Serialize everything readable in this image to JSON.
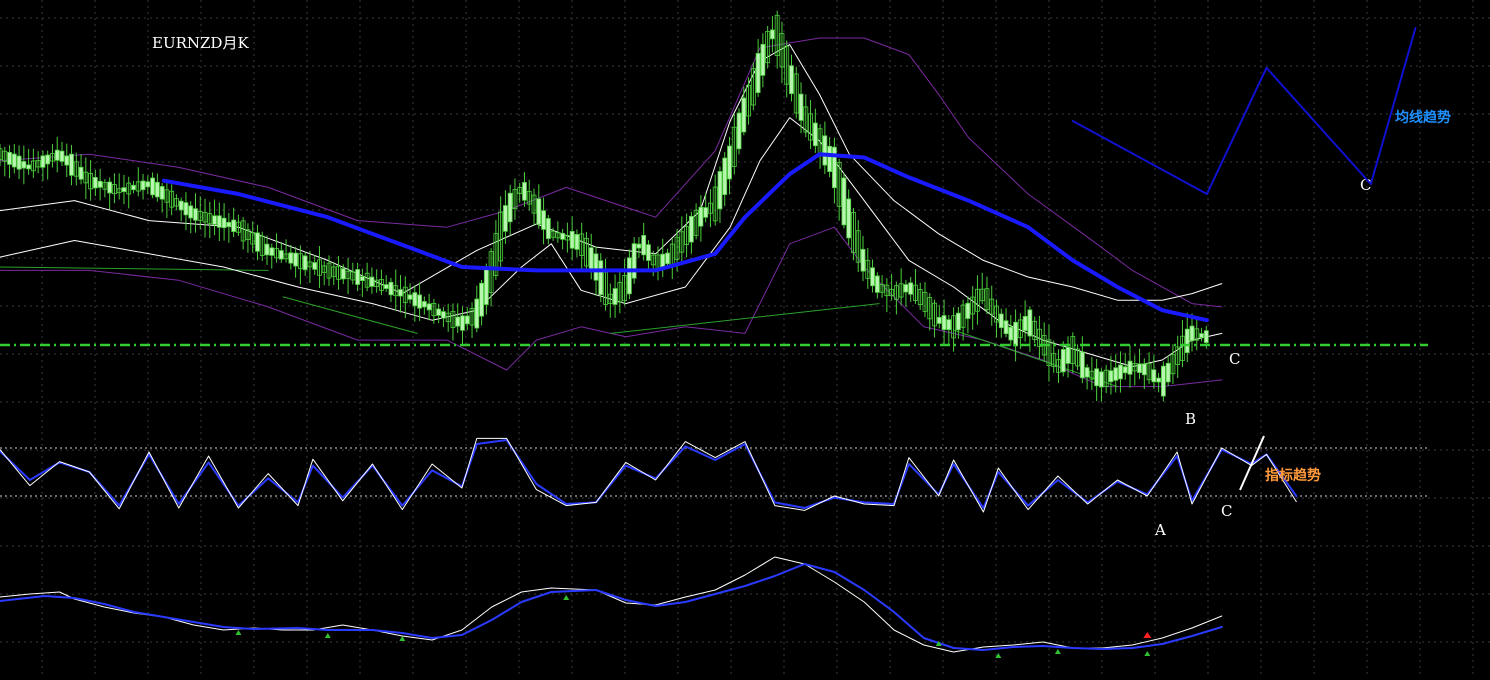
{
  "chart_data": {
    "type": "line",
    "title": "EURNZD月K",
    "grid": true,
    "colors": {
      "background": "#000000",
      "grid": "#3a3a3a",
      "candle": "#b8f5b0",
      "candle_edge": "#4ccf3c",
      "ma": "#1a1aff",
      "band_inner": "#ffffff",
      "band_outer": "#7a2aa0",
      "support": "#33cc33",
      "trendline": "#2aa02a",
      "osc_fast": "#ffffff",
      "osc_slow": "#2a3aff",
      "annot_blue": "#1e90ff",
      "annot_orange": "#ff9a3c",
      "arrow_red": "#ff2020"
    },
    "x_range": [
      0,
      100
    ],
    "price_panel": {
      "y_range": [
        0,
        100
      ],
      "ma_line": [
        [
          11,
          54
        ],
        [
          16,
          50
        ],
        [
          22,
          43
        ],
        [
          28,
          33
        ],
        [
          31,
          28
        ],
        [
          36,
          27
        ],
        [
          40,
          27
        ],
        [
          44,
          27
        ],
        [
          48,
          32
        ],
        [
          50,
          43
        ],
        [
          53,
          56
        ],
        [
          55,
          62
        ],
        [
          58,
          61
        ],
        [
          61,
          55
        ],
        [
          65,
          48
        ],
        [
          69,
          40
        ],
        [
          72,
          30
        ],
        [
          75,
          22
        ],
        [
          78,
          15
        ],
        [
          81,
          12
        ]
      ],
      "upper_inner": [
        [
          0,
          45
        ],
        [
          5,
          48
        ],
        [
          10,
          42
        ],
        [
          16,
          40
        ],
        [
          22,
          30
        ],
        [
          27,
          20
        ],
        [
          32,
          33
        ],
        [
          36,
          41
        ],
        [
          40,
          34
        ],
        [
          44,
          32
        ],
        [
          47,
          45
        ],
        [
          49,
          72
        ],
        [
          51,
          90
        ],
        [
          53,
          95
        ],
        [
          55,
          80
        ],
        [
          57,
          62
        ],
        [
          60,
          48
        ],
        [
          63,
          38
        ],
        [
          66,
          30
        ],
        [
          69,
          25
        ],
        [
          72,
          22
        ],
        [
          75,
          18
        ],
        [
          78,
          18
        ],
        [
          80,
          20
        ],
        [
          82,
          23
        ]
      ],
      "lower_inner": [
        [
          0,
          31
        ],
        [
          5,
          36
        ],
        [
          10,
          32
        ],
        [
          15,
          28
        ],
        [
          20,
          22
        ],
        [
          25,
          17
        ],
        [
          29,
          12
        ],
        [
          32,
          15
        ],
        [
          35,
          28
        ],
        [
          37,
          35
        ],
        [
          39,
          21
        ],
        [
          42,
          17
        ],
        [
          46,
          22
        ],
        [
          49,
          40
        ],
        [
          51,
          60
        ],
        [
          53,
          73
        ],
        [
          55,
          66
        ],
        [
          58,
          48
        ],
        [
          61,
          30
        ],
        [
          64,
          22
        ],
        [
          67,
          12
        ],
        [
          70,
          6
        ],
        [
          73,
          2
        ],
        [
          76,
          -2
        ],
        [
          78,
          0
        ],
        [
          80,
          6
        ],
        [
          82,
          8
        ]
      ],
      "upper_outer": [
        [
          0,
          60
        ],
        [
          6,
          62
        ],
        [
          12,
          58
        ],
        [
          18,
          52
        ],
        [
          24,
          42
        ],
        [
          30,
          40
        ],
        [
          34,
          45
        ],
        [
          38,
          52
        ],
        [
          44,
          43
        ],
        [
          48,
          63
        ],
        [
          51,
          94
        ],
        [
          55,
          97
        ],
        [
          58,
          97
        ],
        [
          61,
          92
        ],
        [
          63,
          80
        ],
        [
          65,
          67
        ],
        [
          69,
          50
        ],
        [
          73,
          37
        ],
        [
          76,
          27
        ],
        [
          80,
          17
        ],
        [
          82,
          16
        ]
      ],
      "lower_outer": [
        [
          0,
          27
        ],
        [
          6,
          27
        ],
        [
          12,
          24
        ],
        [
          18,
          16
        ],
        [
          24,
          6
        ],
        [
          30,
          6
        ],
        [
          34,
          -3
        ],
        [
          36,
          6
        ],
        [
          39,
          10
        ],
        [
          42,
          7
        ],
        [
          46,
          10
        ],
        [
          50,
          8
        ],
        [
          53,
          35
        ],
        [
          56,
          40
        ],
        [
          58,
          28
        ],
        [
          62,
          10
        ],
        [
          66,
          6
        ],
        [
          70,
          0
        ],
        [
          74,
          -8
        ],
        [
          78,
          -8
        ],
        [
          82,
          -6
        ]
      ],
      "support_level": 4.5,
      "trend_lines": [
        [
          [
            0,
            28
          ],
          [
            18,
            27
          ]
        ],
        [
          [
            19,
            19
          ],
          [
            28,
            8
          ]
        ],
        [
          [
            41,
            8
          ],
          [
            59,
            17
          ]
        ],
        [
          [
            64,
            9
          ],
          [
            75,
            -8
          ]
        ]
      ],
      "candle_path": [
        [
          0,
          62
        ],
        [
          2,
          58
        ],
        [
          4,
          62
        ],
        [
          6,
          54
        ],
        [
          8,
          51
        ],
        [
          10,
          53
        ],
        [
          13,
          44
        ],
        [
          16,
          40
        ],
        [
          18,
          33
        ],
        [
          20,
          30
        ],
        [
          22,
          27
        ],
        [
          24,
          25
        ],
        [
          26,
          22
        ],
        [
          28,
          18
        ],
        [
          30,
          13
        ],
        [
          31,
          11
        ],
        [
          32,
          14
        ],
        [
          33,
          27
        ],
        [
          34,
          44
        ],
        [
          35,
          52
        ],
        [
          36,
          46
        ],
        [
          37,
          38
        ],
        [
          38,
          37
        ],
        [
          39,
          35
        ],
        [
          40,
          28
        ],
        [
          41,
          18
        ],
        [
          42,
          22
        ],
        [
          43,
          36
        ],
        [
          44,
          29
        ],
        [
          45,
          31
        ],
        [
          46,
          37
        ],
        [
          47,
          43
        ],
        [
          48,
          47
        ],
        [
          49,
          60
        ],
        [
          50,
          75
        ],
        [
          51,
          88
        ],
        [
          52,
          100
        ],
        [
          53,
          86
        ],
        [
          54,
          73
        ],
        [
          55,
          66
        ],
        [
          56,
          58
        ],
        [
          57,
          42
        ],
        [
          58,
          29
        ],
        [
          59,
          22
        ],
        [
          60,
          20
        ],
        [
          61,
          22
        ],
        [
          62,
          18
        ],
        [
          63,
          12
        ],
        [
          64,
          10
        ],
        [
          65,
          15
        ],
        [
          66,
          20
        ],
        [
          67,
          13
        ],
        [
          68,
          7
        ],
        [
          69,
          12
        ],
        [
          70,
          5
        ],
        [
          71,
          -2
        ],
        [
          72,
          3
        ],
        [
          73,
          -4
        ],
        [
          74,
          -6
        ],
        [
          75,
          -4
        ],
        [
          76,
          -2
        ],
        [
          77,
          -3
        ],
        [
          78,
          -7
        ],
        [
          79,
          1
        ],
        [
          80,
          8
        ],
        [
          81,
          7
        ]
      ]
    },
    "oscillator_panel": {
      "y_range": [
        0,
        100
      ],
      "levels": [
        80,
        20
      ],
      "fast": [
        [
          0,
          78
        ],
        [
          2,
          33
        ],
        [
          4,
          63
        ],
        [
          6,
          50
        ],
        [
          8,
          4
        ],
        [
          10,
          75
        ],
        [
          12,
          5
        ],
        [
          14,
          70
        ],
        [
          16,
          5
        ],
        [
          18,
          48
        ],
        [
          20,
          8
        ],
        [
          21,
          66
        ],
        [
          23,
          14
        ],
        [
          25,
          60
        ],
        [
          27,
          3
        ],
        [
          29,
          60
        ],
        [
          31,
          30
        ],
        [
          32,
          92
        ],
        [
          34,
          92
        ],
        [
          36,
          28
        ],
        [
          38,
          8
        ],
        [
          40,
          12
        ],
        [
          42,
          62
        ],
        [
          44,
          40
        ],
        [
          46,
          88
        ],
        [
          48,
          68
        ],
        [
          50,
          88
        ],
        [
          52,
          8
        ],
        [
          54,
          2
        ],
        [
          56,
          20
        ],
        [
          58,
          10
        ],
        [
          60,
          8
        ],
        [
          61,
          68
        ],
        [
          63,
          20
        ],
        [
          64,
          65
        ],
        [
          66,
          0
        ],
        [
          67,
          55
        ],
        [
          69,
          3
        ],
        [
          71,
          45
        ],
        [
          73,
          10
        ],
        [
          75,
          40
        ],
        [
          77,
          20
        ],
        [
          79,
          75
        ],
        [
          80,
          10
        ],
        [
          82,
          80
        ],
        [
          84,
          58
        ],
        [
          85,
          72
        ],
        [
          87,
          13
        ]
      ],
      "slow": [
        [
          0,
          76
        ],
        [
          2,
          40
        ],
        [
          4,
          62
        ],
        [
          6,
          50
        ],
        [
          8,
          8
        ],
        [
          10,
          72
        ],
        [
          12,
          10
        ],
        [
          14,
          62
        ],
        [
          16,
          8
        ],
        [
          18,
          42
        ],
        [
          20,
          12
        ],
        [
          21,
          58
        ],
        [
          23,
          18
        ],
        [
          25,
          58
        ],
        [
          27,
          8
        ],
        [
          29,
          52
        ],
        [
          31,
          32
        ],
        [
          32,
          85
        ],
        [
          34,
          90
        ],
        [
          36,
          35
        ],
        [
          38,
          10
        ],
        [
          40,
          12
        ],
        [
          42,
          58
        ],
        [
          44,
          42
        ],
        [
          46,
          82
        ],
        [
          48,
          65
        ],
        [
          50,
          85
        ],
        [
          52,
          12
        ],
        [
          54,
          5
        ],
        [
          56,
          18
        ],
        [
          58,
          12
        ],
        [
          60,
          10
        ],
        [
          61,
          60
        ],
        [
          63,
          22
        ],
        [
          64,
          60
        ],
        [
          66,
          5
        ],
        [
          67,
          50
        ],
        [
          69,
          8
        ],
        [
          71,
          40
        ],
        [
          73,
          12
        ],
        [
          75,
          38
        ],
        [
          77,
          22
        ],
        [
          79,
          70
        ],
        [
          80,
          14
        ],
        [
          82,
          78
        ],
        [
          84,
          60
        ],
        [
          85,
          72
        ],
        [
          87,
          20
        ]
      ]
    },
    "lower_panel": {
      "y_range": [
        0,
        100
      ],
      "fast": [
        [
          0,
          63
        ],
        [
          2,
          66
        ],
        [
          4,
          68
        ],
        [
          5,
          61
        ],
        [
          7,
          53
        ],
        [
          9,
          47
        ],
        [
          11,
          43
        ],
        [
          13,
          35
        ],
        [
          15,
          30
        ],
        [
          17,
          32
        ],
        [
          19,
          30
        ],
        [
          21,
          30
        ],
        [
          23,
          35
        ],
        [
          25,
          30
        ],
        [
          27,
          24
        ],
        [
          29,
          20
        ],
        [
          31,
          30
        ],
        [
          33,
          53
        ],
        [
          35,
          68
        ],
        [
          37,
          72
        ],
        [
          40,
          70
        ],
        [
          42,
          57
        ],
        [
          44,
          55
        ],
        [
          46,
          63
        ],
        [
          48,
          70
        ],
        [
          50,
          85
        ],
        [
          52,
          103
        ],
        [
          54,
          96
        ],
        [
          56,
          78
        ],
        [
          58,
          58
        ],
        [
          60,
          30
        ],
        [
          62,
          15
        ],
        [
          64,
          8
        ],
        [
          66,
          13
        ],
        [
          68,
          15
        ],
        [
          70,
          18
        ],
        [
          72,
          12
        ],
        [
          74,
          12
        ],
        [
          76,
          15
        ],
        [
          78,
          22
        ],
        [
          80,
          32
        ],
        [
          82,
          44
        ]
      ],
      "slow": [
        [
          0,
          59
        ],
        [
          3,
          64
        ],
        [
          5,
          62
        ],
        [
          7,
          56
        ],
        [
          9,
          48
        ],
        [
          11,
          43
        ],
        [
          13,
          38
        ],
        [
          15,
          33
        ],
        [
          17,
          31
        ],
        [
          20,
          32
        ],
        [
          22,
          30
        ],
        [
          25,
          30
        ],
        [
          27,
          27
        ],
        [
          29,
          22
        ],
        [
          31,
          25
        ],
        [
          33,
          40
        ],
        [
          35,
          58
        ],
        [
          37,
          68
        ],
        [
          40,
          70
        ],
        [
          42,
          60
        ],
        [
          44,
          54
        ],
        [
          46,
          58
        ],
        [
          48,
          66
        ],
        [
          50,
          74
        ],
        [
          52,
          84
        ],
        [
          54,
          96
        ],
        [
          56,
          88
        ],
        [
          58,
          70
        ],
        [
          60,
          48
        ],
        [
          62,
          22
        ],
        [
          64,
          12
        ],
        [
          66,
          10
        ],
        [
          68,
          13
        ],
        [
          70,
          14
        ],
        [
          72,
          12
        ],
        [
          74,
          11
        ],
        [
          76,
          12
        ],
        [
          78,
          16
        ],
        [
          80,
          24
        ],
        [
          82,
          33
        ]
      ]
    },
    "annotations": {
      "trend_label": "均线趋势",
      "indicator_label": "指标趋势",
      "c_top": "C",
      "c_price": "C",
      "b": "B",
      "a": "A",
      "c_osc": "C"
    },
    "trend_sketch": [
      [
        72,
        72
      ],
      [
        81,
        50
      ],
      [
        85,
        88
      ],
      [
        92,
        53
      ],
      [
        95,
        100
      ]
    ]
  }
}
